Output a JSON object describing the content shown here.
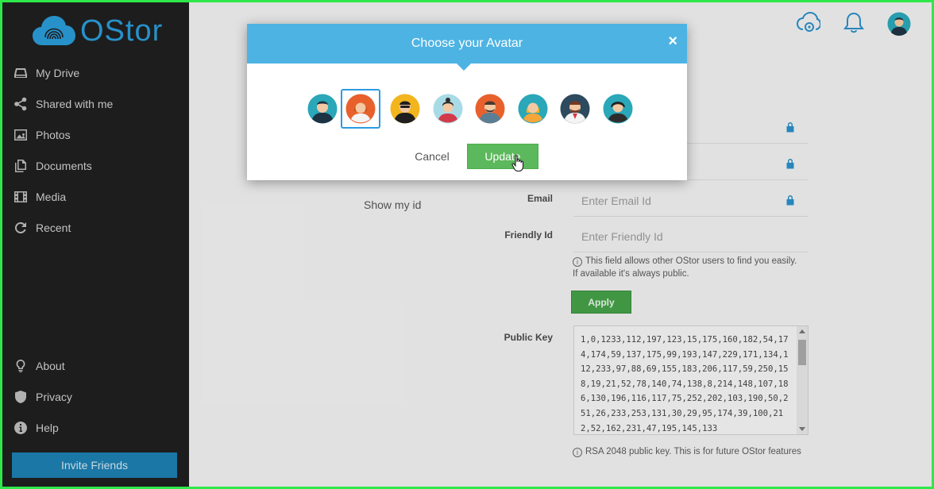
{
  "app": {
    "name": "OStor"
  },
  "sidebar": {
    "nav_top": [
      {
        "label": "My Drive",
        "icon": "drive-icon"
      },
      {
        "label": "Shared with me",
        "icon": "share-icon"
      },
      {
        "label": "Photos",
        "icon": "photo-icon"
      },
      {
        "label": "Documents",
        "icon": "documents-icon"
      },
      {
        "label": "Media",
        "icon": "film-icon"
      },
      {
        "label": "Recent",
        "icon": "refresh-icon"
      }
    ],
    "nav_bottom": [
      {
        "label": "About",
        "icon": "lightbulb-icon"
      },
      {
        "label": "Privacy",
        "icon": "shield-icon"
      },
      {
        "label": "Help",
        "icon": "info-icon"
      }
    ],
    "invite_label": "Invite Friends"
  },
  "profile": {
    "show_id_label": "Show my id",
    "email_label": "Email",
    "email_placeholder": "Enter Email Id",
    "friendly_id_label": "Friendly Id",
    "friendly_id_placeholder": "Enter Friendly Id",
    "friendly_hint": "This field allows other OStor users to find you easily. If available it's always public.",
    "apply_label": "Apply",
    "public_key_label": "Public Key",
    "public_key_value": "1,0,1233,112,197,123,15,175,160,182,54,174,174,59,137,175,99,193,147,229,171,134,112,233,97,88,69,155,183,206,117,59,250,158,19,21,52,78,140,74,138,8,214,148,107,186,130,196,116,117,75,252,202,103,190,50,251,26,233,253,131,30,29,95,174,39,100,212,52,162,231,47,195,145,133",
    "key_hint": "RSA 2048 public key. This is for future OStor features"
  },
  "modal": {
    "title": "Choose your Avatar",
    "close_label": "×",
    "cancel_label": "Cancel",
    "update_label": "Update",
    "selected_index": 1,
    "avatars": [
      {
        "bg": "#2aa7b8"
      },
      {
        "bg": "#e8612c"
      },
      {
        "bg": "#f2b51d"
      },
      {
        "bg": "#a9dbe6"
      },
      {
        "bg": "#e8612c"
      },
      {
        "bg": "#2aa7b8"
      },
      {
        "bg": "#2d4a5e"
      },
      {
        "bg": "#2aa7b8"
      }
    ]
  },
  "colors": {
    "accent": "#4db3e3",
    "sidebar_bg": "#1f1f1f",
    "update_green": "#5cb85c",
    "apply_green": "#46a049",
    "logo_blue": "#2a9bd6"
  }
}
